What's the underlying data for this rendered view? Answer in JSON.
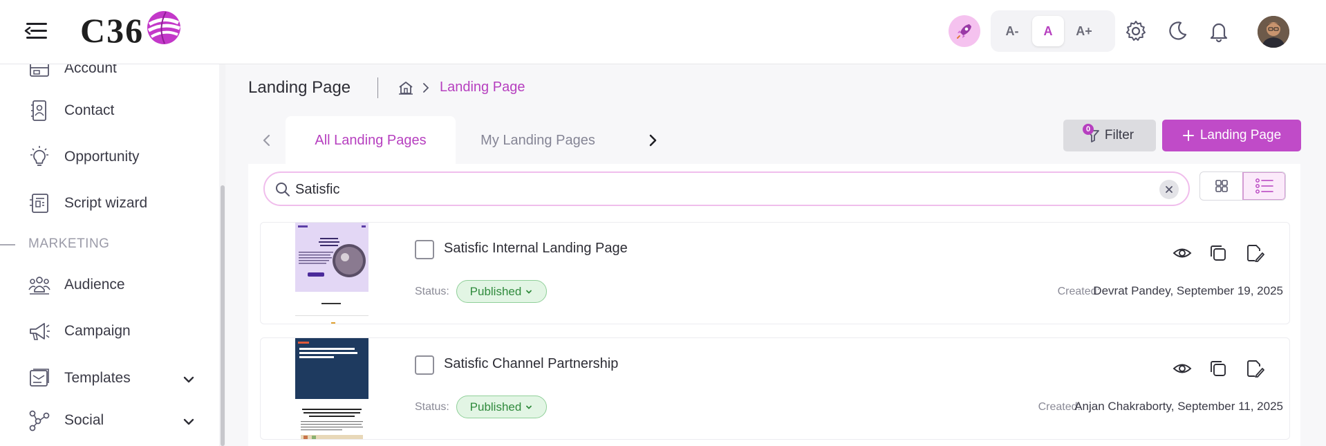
{
  "header": {
    "logo_text": "C36",
    "font_small": "A-",
    "font_normal": "A",
    "font_large": "A+"
  },
  "sidebar": {
    "items": [
      {
        "label": "Account",
        "icon": "account-icon"
      },
      {
        "label": "Contact",
        "icon": "contact-icon"
      },
      {
        "label": "Opportunity",
        "icon": "lightbulb-icon"
      },
      {
        "label": "Script wizard",
        "icon": "script-wizard-icon"
      }
    ],
    "section_label": "MARKETING",
    "marketing_items": [
      {
        "label": "Audience",
        "icon": "audience-icon"
      },
      {
        "label": "Campaign",
        "icon": "megaphone-icon"
      },
      {
        "label": "Templates",
        "icon": "templates-icon"
      },
      {
        "label": "Social",
        "icon": "social-icon"
      }
    ]
  },
  "main": {
    "page_title": "Landing Page",
    "breadcrumb_current": "Landing Page",
    "tabs": [
      {
        "label": "All Landing Pages",
        "active": true
      },
      {
        "label": "My Landing Pages",
        "active": false
      }
    ],
    "filter_label": "Filter",
    "filter_count": "0",
    "add_label": "Landing Page",
    "search_value": "Satisfic",
    "cards": [
      {
        "title": "Satisfic Internal Landing Page",
        "status_label": "Status:",
        "status": "Published",
        "created_label": "Created:",
        "created_value": "Devrat Pandey, September 19, 2025"
      },
      {
        "title": "Satisfic Channel Partnership",
        "status_label": "Status:",
        "status": "Published",
        "created_label": "Created:",
        "created_value": "Anjan Chakraborty, September 11, 2025"
      }
    ]
  },
  "colors": {
    "accent": "#b63fbf",
    "accent_button": "#c04bc8",
    "status_green": "#2f8a3c"
  }
}
